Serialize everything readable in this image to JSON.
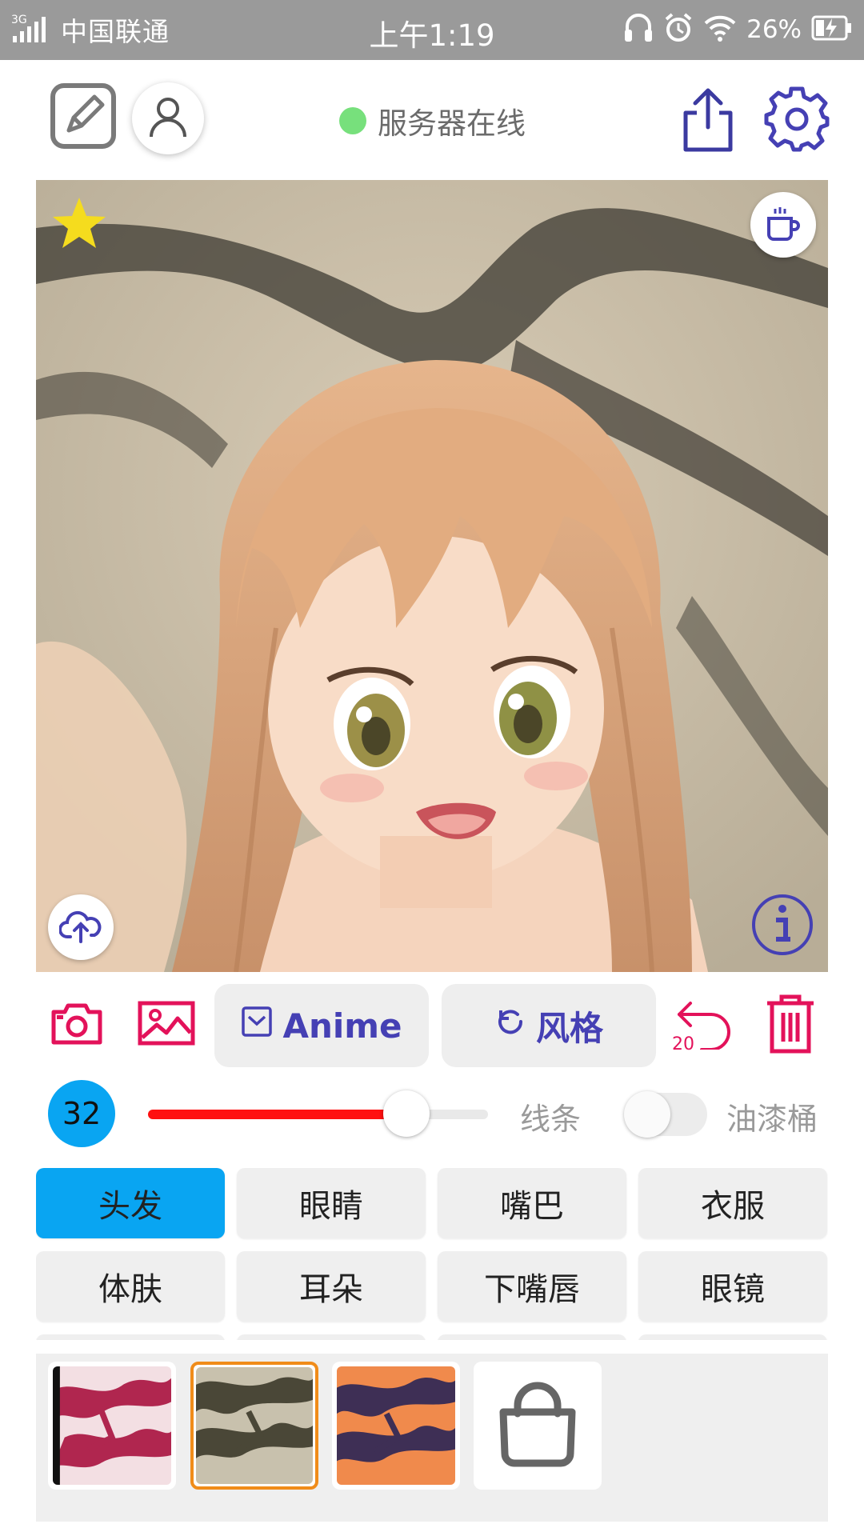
{
  "status_bar": {
    "network": "3G",
    "carrier": "中国联通",
    "time": "上午1:19",
    "battery": "26%"
  },
  "header": {
    "server_status": "服务器在线",
    "server_status_color": "#77e07c"
  },
  "toolbar": {
    "model_label": "Anime",
    "style_label": "风格",
    "undo_count": "20",
    "accent_color": "#e3125a",
    "primary_color": "#4540b4"
  },
  "brush": {
    "size": "32",
    "slider_fraction": 0.76,
    "lines_label": "线条",
    "bucket_label": "油漆桶",
    "bucket_enabled": false
  },
  "categories": {
    "row1": [
      "头发",
      "眼睛",
      "嘴巴",
      "衣服"
    ],
    "row2": [
      "体肤",
      "耳朵",
      "下嘴唇",
      "眼镜"
    ],
    "selected": "头发"
  },
  "palette": {
    "swatches": [
      "pink",
      "grey-green",
      "orange"
    ],
    "selected_index": 1
  }
}
